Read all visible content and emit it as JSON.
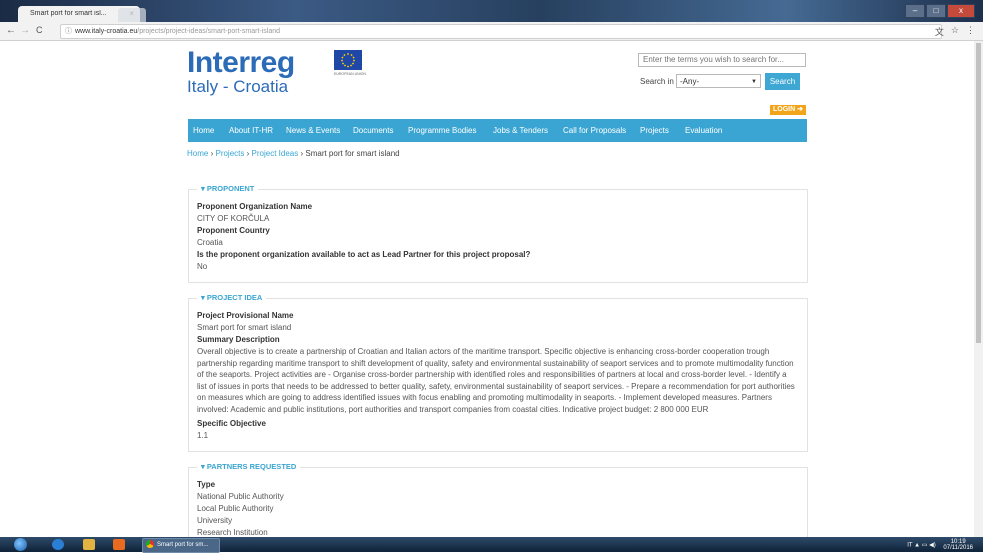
{
  "browser": {
    "tab_title": "Smart port for smart isl...",
    "tab_close": "×",
    "url_host": "www.italy-croatia.eu",
    "url_path": "/projects/project-ideas/smart-port-smart-island",
    "back": "←",
    "forward": "→",
    "reload": "C",
    "info": "ⓘ",
    "translate_icon": "文",
    "star_icon": "☆",
    "menu_icon": "⋮",
    "win_min": "–",
    "win_max": "□",
    "win_close": "x"
  },
  "header": {
    "logo_title": "Interreg",
    "logo_subtitle": "Italy - Croatia",
    "eu_label": "EUROPEAN UNION",
    "search_placeholder": "Enter the terms you wish to search for...",
    "search_in_label": "Search in",
    "search_select_value": "-Any-",
    "search_button": "Search",
    "login": "LOGIN"
  },
  "nav": {
    "items": [
      "Home",
      "About IT-HR",
      "News & Events",
      "Documents",
      "Programme Bodies",
      "Jobs & Tenders",
      "Call for Proposals",
      "Projects",
      "Evaluation"
    ]
  },
  "breadcrumb": {
    "items": [
      "Home",
      "Projects",
      "Project Ideas"
    ],
    "separator": "›",
    "current": "Smart port for smart island"
  },
  "proponent": {
    "legend": "PROPONENT",
    "org_label": "Proponent Organization Name",
    "org_value": "CITY OF KORČULA",
    "country_label": "Proponent Country",
    "country_value": "Croatia",
    "lead_label": "Is the proponent organization available to act as Lead Partner for this project proposal?",
    "lead_value": "No"
  },
  "project_idea": {
    "legend": "PROJECT IDEA",
    "name_label": "Project Provisional Name",
    "name_value": "Smart port for smart island",
    "summary_label": "Summary Description",
    "summary_value": "Overall objective is to create a partnership of Croatian and Italian actors of the maritime transport. Specific objective is enhancing cross-border cooperation trough partnership regarding maritime transport to shift development of quality, safety and environmental sustainability of seaport services and to promote multimodality function of the seaports. Project activities are - Organise cross-border partnership with identified roles and responsibilities of partners at local and cross-border level. - Identify a list of issues in ports that needs to be addressed to better quality, safety, environmental sustainability of seaport services. - Prepare a recommendation for port authorities on measures which are going to address identified issues with focus enabling and promoting multimodality in seaports. - Implement developed measures. Partners involved: Academic and public institutions, port authorities and transport companies from coastal cities. Indicative project budget: 2 800 000 EUR",
    "objective_label": "Specific Objective",
    "objective_value": "1.1"
  },
  "partners": {
    "legend": "PARTNERS REQUESTED",
    "type_label": "Type",
    "types": [
      "National Public Authority",
      "Local Public Authority",
      "University",
      "Research Institution"
    ]
  },
  "taskbar": {
    "task_label": "Smart port for sm...",
    "lang": "IT",
    "time": "10:19",
    "date": "07/11/2016"
  },
  "colors": {
    "brand_blue": "#2c6bb8",
    "nav_blue": "#3aa5d2",
    "login_orange": "#f2a51a"
  }
}
